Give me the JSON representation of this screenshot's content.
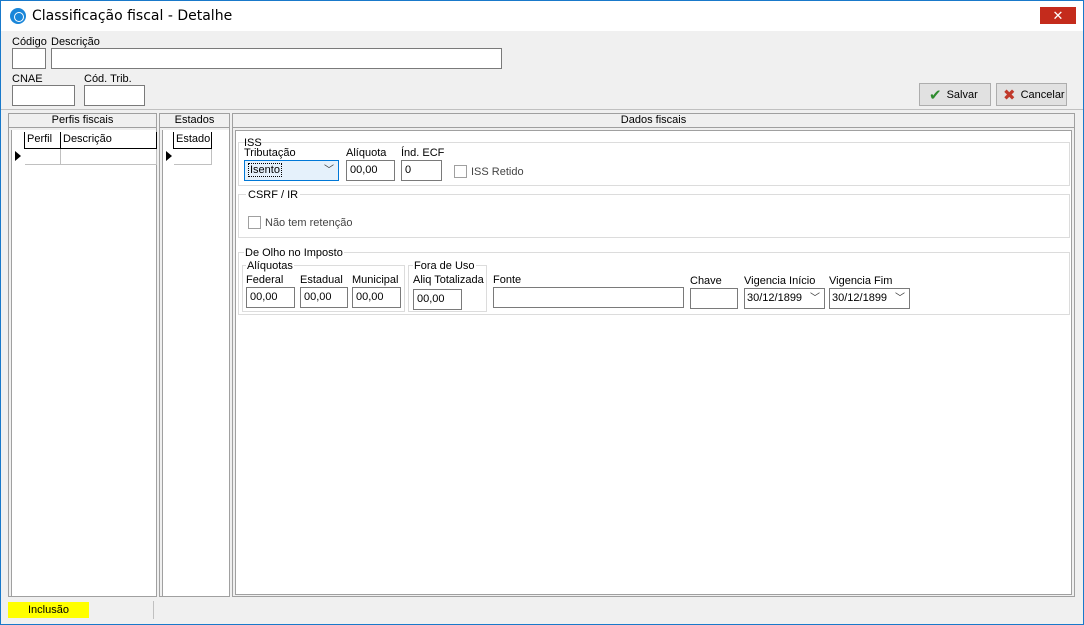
{
  "window": {
    "title": "Classificação fiscal - Detalhe",
    "close_label": "✕"
  },
  "header": {
    "codigo_label": "Código",
    "codigo_value": "",
    "descricao_label": "Descrição",
    "descricao_value": "",
    "cnae_label": "CNAE",
    "cnae_value": "",
    "cod_trib_label": "Cód. Trib.",
    "cod_trib_value": "",
    "salvar_label": "Salvar",
    "cancelar_label": "Cancelar"
  },
  "perfis": {
    "title": "Perfis fiscais",
    "col_perfil": "Perfil",
    "col_descricao": "Descrição"
  },
  "estados": {
    "title": "Estados",
    "col_estado": "Estado"
  },
  "dados": {
    "title": "Dados fiscais",
    "iss": {
      "group_label": "ISS",
      "tributacao_label": "Tributação",
      "tributacao_value": "Isento",
      "aliquota_label": "Alíquota",
      "aliquota_value": "00,00",
      "ind_ecf_label": "Índ. ECF",
      "ind_ecf_value": "0",
      "iss_retido_label": "ISS Retido"
    },
    "csrf": {
      "group_label": "CSRF / IR",
      "nao_tem_retencao_label": "Não tem retenção"
    },
    "olho": {
      "group_label": "De Olho no Imposto",
      "aliquotas_label": "Alíquotas",
      "federal_label": "Federal",
      "federal_value": "00,00",
      "estadual_label": "Estadual",
      "estadual_value": "00,00",
      "municipal_label": "Municipal",
      "municipal_value": "00,00",
      "fora_uso_label": "Fora de Uso",
      "aliq_totalizada_label": "Aliq Totalizada",
      "aliq_totalizada_value": "00,00",
      "fonte_label": "Fonte",
      "fonte_value": "",
      "chave_label": "Chave",
      "chave_value": "",
      "vig_inicio_label": "Vigencia Início",
      "vig_inicio_value": "30/12/1899",
      "vig_fim_label": "Vigencia Fim",
      "vig_fim_value": "30/12/1899"
    }
  },
  "status": {
    "mode": "Inclusão"
  }
}
